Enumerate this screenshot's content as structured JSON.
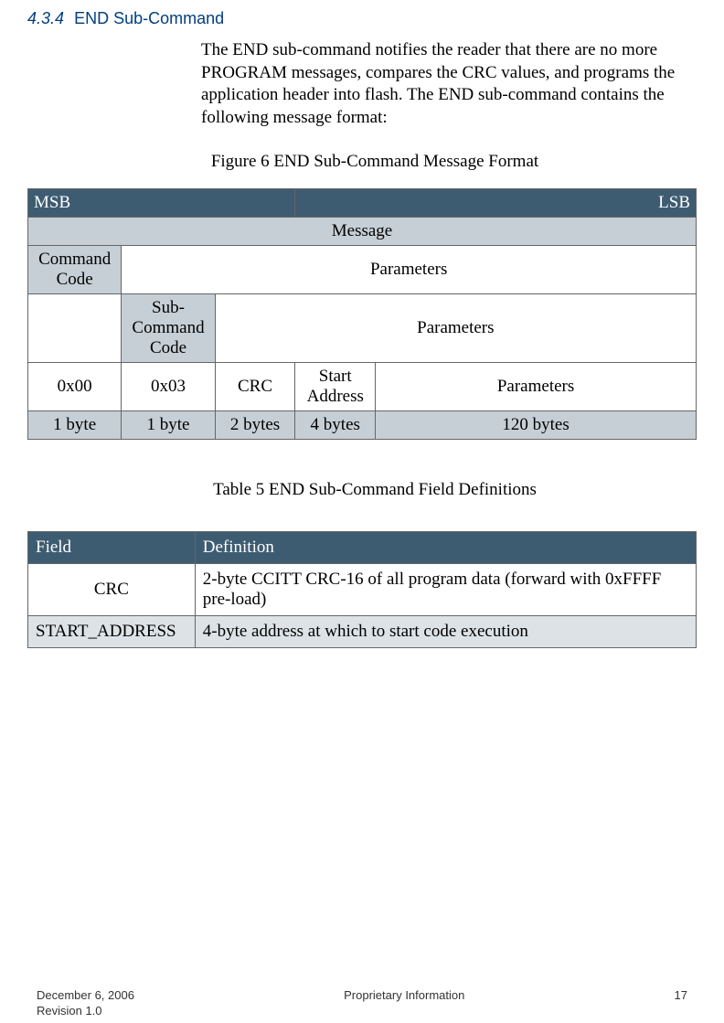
{
  "heading": {
    "number": "4.3.4",
    "title": "END Sub-Command"
  },
  "intro": "The END sub-command notifies the reader that there are no more PROGRAM messages, compares the CRC values, and programs the application header into flash.  The END sub-command contains the following message format:",
  "fig6_caption": "Figure 6 END Sub-Command Message Format",
  "msgfmt": {
    "msb": "MSB",
    "lsb": "LSB",
    "message": "Message",
    "command_code": "Command Code",
    "parameters": "Parameters",
    "sub_command_code": "Sub-Command Code",
    "row_vals": {
      "c0": "0x00",
      "c1": "0x03",
      "c2": "CRC",
      "c3": "Start Address",
      "c4": "Parameters"
    },
    "row_sizes": {
      "c0": "1 byte",
      "c1": "1 byte",
      "c2": "2 bytes",
      "c3": "4 bytes",
      "c4": "120 bytes"
    }
  },
  "table5_caption": "Table 5 END Sub-Command Field Definitions",
  "fielddef": {
    "h0": "Field",
    "h1": "Definition",
    "rows": [
      {
        "field": "CRC",
        "def": "2-byte CCITT CRC-16 of all program data (forward with 0xFFFF pre-load)"
      },
      {
        "field": "START_ADDRESS",
        "def": "4-byte address at which to start code execution"
      }
    ]
  },
  "footer": {
    "date": "December 6, 2006",
    "rev": "Revision 1.0",
    "center": "Proprietary Information",
    "page": "17"
  }
}
